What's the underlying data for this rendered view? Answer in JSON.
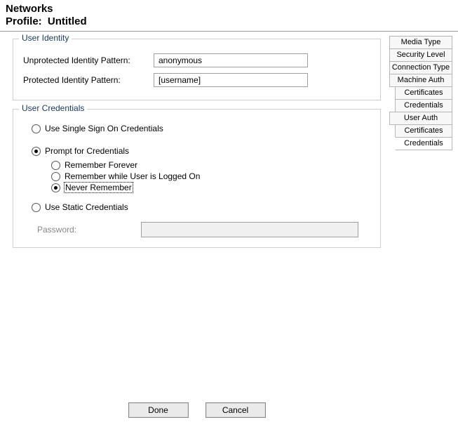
{
  "header": {
    "title": "Networks",
    "profile_label": "Profile:",
    "profile_name": "Untitled"
  },
  "user_identity": {
    "group_title": "User Identity",
    "unprotected_label": "Unprotected Identity Pattern:",
    "unprotected_value": "anonymous",
    "protected_label": "Protected Identity Pattern:",
    "protected_value": "[username]"
  },
  "user_credentials": {
    "group_title": "User Credentials",
    "sso_label": "Use Single Sign On Credentials",
    "prompt_label": "Prompt for Credentials",
    "remember_forever_label": "Remember Forever",
    "remember_logged_label": "Remember while User is Logged On",
    "never_remember_label": "Never Remember",
    "static_label": "Use Static Credentials",
    "password_label": "Password:",
    "main_selected": "prompt",
    "prompt_sub_selected": "never"
  },
  "buttons": {
    "done": "Done",
    "cancel": "Cancel"
  },
  "sidebar": {
    "items": [
      {
        "label": "Media Type",
        "indent": false,
        "selected": false
      },
      {
        "label": "Security Level",
        "indent": false,
        "selected": false
      },
      {
        "label": "Connection Type",
        "indent": false,
        "selected": false
      },
      {
        "label": "Machine Auth",
        "indent": false,
        "selected": false
      },
      {
        "label": "Certificates",
        "indent": true,
        "selected": false
      },
      {
        "label": "Credentials",
        "indent": true,
        "selected": false
      },
      {
        "label": "User Auth",
        "indent": false,
        "selected": false
      },
      {
        "label": "Certificates",
        "indent": true,
        "selected": false
      },
      {
        "label": "Credentials",
        "indent": true,
        "selected": true
      }
    ]
  }
}
